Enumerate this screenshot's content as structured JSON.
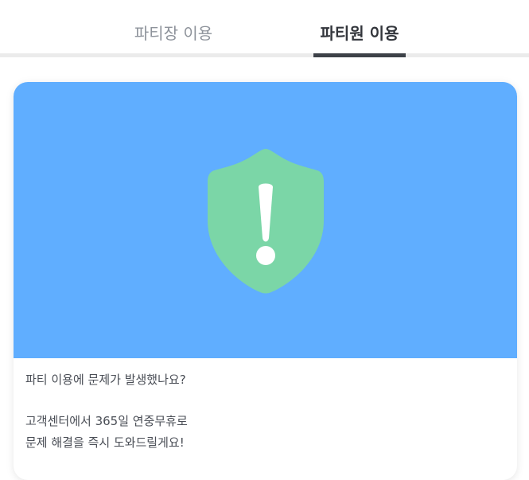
{
  "tabs": {
    "host_label": "파티장 이용",
    "member_label": "파티원 이용",
    "active": "member"
  },
  "card": {
    "icon": "shield-exclamation-icon",
    "hero_color": "#60aeff",
    "shield_color": "#7bd6a7",
    "question": "파티 이용에 문제가 발생했나요?",
    "line1": "고객센터에서 365일 연중무휴로",
    "line2": "문제 해결을 즉시 도와드릴게요!"
  }
}
